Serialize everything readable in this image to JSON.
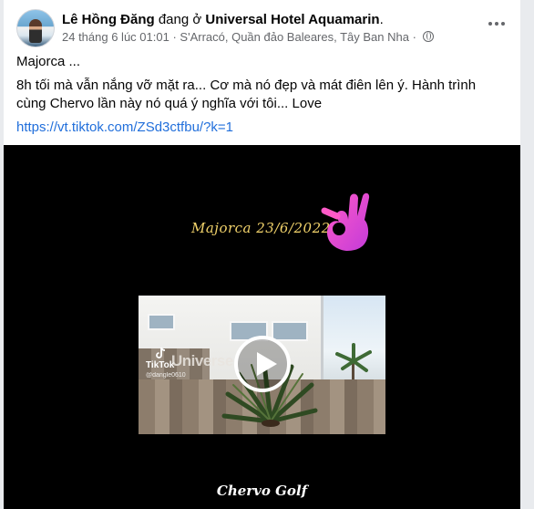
{
  "post": {
    "author": "Lê Hồng Đăng",
    "location_prefix": "đang ở",
    "location": "Universal Hotel Aquamarin",
    "location_suffix": ".",
    "timestamp": "24 tháng 6 lúc 01:01",
    "separator": "·",
    "place": "S'Arracó, Quần đảo Baleares, Tây Ban Nha",
    "separator2": "·",
    "privacy_icon": "globe-icon",
    "more_icon": "more-options-icon",
    "text_line1": "Majorca ...",
    "text_line2": "8h tối mà vẫn nắng vỡ mặt ra... Cơ mà nó đẹp và mát điên lên ý. Hành trình cùng Chervo lần này nó quá ý nghĩa với tôi... Love",
    "link": "https://vt.tiktok.com/ZSd3ctfbu/?k=1"
  },
  "video": {
    "overlay_title": "Majorca  23/6/2022",
    "emoji": "ok-hand-emoji",
    "watermark_brand": "TikTok",
    "watermark_user": "@dangle0610",
    "sign_text": "Universe",
    "play_icon": "play-icon",
    "footer_text": "Chervo Golf",
    "colors": {
      "title": "#f2d36b",
      "background": "#000000",
      "link": "#216fdb"
    }
  }
}
